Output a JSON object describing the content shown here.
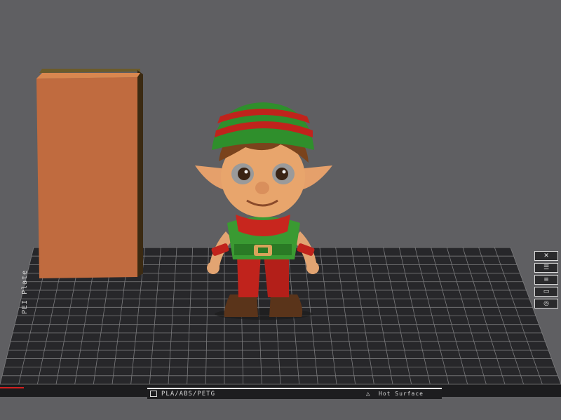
{
  "viewport": {
    "background": "#5f5f62",
    "build_plate": {
      "plate_type": "PLA/ABS/PETG",
      "surface_type": "Hot Surface",
      "side_label": "PEI Plate",
      "plate_color": "#27272a",
      "grid_color": "#8a8a8a"
    },
    "objects": [
      {
        "name": "wipe-tower",
        "color": "#c06b3f"
      },
      {
        "name": "elf-figurine",
        "colors": [
          "#2f8f2c",
          "#c0231c",
          "#e5a06b",
          "#6b3a1c",
          "#4a2a14"
        ]
      }
    ],
    "legend_icons": [
      "close-icon",
      "layers-icon",
      "layers-icon",
      "lock-icon",
      "eye-icon"
    ]
  }
}
